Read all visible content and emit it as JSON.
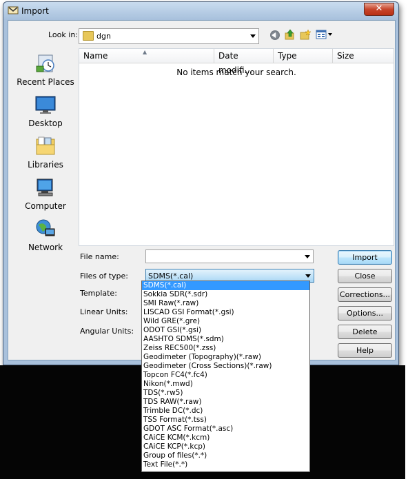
{
  "window": {
    "title": "Import",
    "close_glyph": "✕"
  },
  "lookin": {
    "label": "Look in:",
    "value": "dgn"
  },
  "places": [
    {
      "label": "Recent Places",
      "icon": "recent-places-icon"
    },
    {
      "label": "Desktop",
      "icon": "desktop-icon"
    },
    {
      "label": "Libraries",
      "icon": "libraries-icon"
    },
    {
      "label": "Computer",
      "icon": "computer-icon"
    },
    {
      "label": "Network",
      "icon": "network-icon"
    }
  ],
  "filelist": {
    "columns": [
      "Name",
      "Date modifi...",
      "Type",
      "Size"
    ],
    "empty_message": "No items match your search."
  },
  "form": {
    "file_name_label": "File name:",
    "file_name_value": "",
    "files_of_type_label": "Files of type:",
    "files_of_type_value": "SDMS(*.cal)",
    "template_label": "Template:",
    "linear_units_label": "Linear Units:",
    "angular_units_label": "Angular Units:"
  },
  "file_types": [
    "SDMS(*.cal)",
    "Sokkia SDR(*.sdr)",
    "SMI Raw(*.raw)",
    "LISCAD GSI Format(*.gsi)",
    "Wild GRE(*.gre)",
    "ODOT GSI(*.gsi)",
    "AASHTO SDMS(*.sdm)",
    "Zeiss REC500(*.zss)",
    "Geodimeter (Topography)(*.raw)",
    "Geodimeter (Cross Sections)(*.raw)",
    "Topcon FC4(*.fc4)",
    "Nikon(*.mwd)",
    "TDS(*.rw5)",
    "TDS RAW(*.raw)",
    "Trimble DC(*.dc)",
    "TSS Format(*.tss)",
    "GDOT ASC Format(*.asc)",
    "CAiCE KCM(*.kcm)",
    "CAiCE KCP(*.kcp)",
    "Group of files(*.*)",
    "Text File(*.*)"
  ],
  "buttons": {
    "import": "Import",
    "close": "Close",
    "corrections": "Corrections...",
    "options": "Options...",
    "delete": "Delete",
    "help": "Help"
  },
  "colors": {
    "selection": "#3399ff",
    "frame": "#a9c1dc",
    "close_button": "#c7452b"
  }
}
